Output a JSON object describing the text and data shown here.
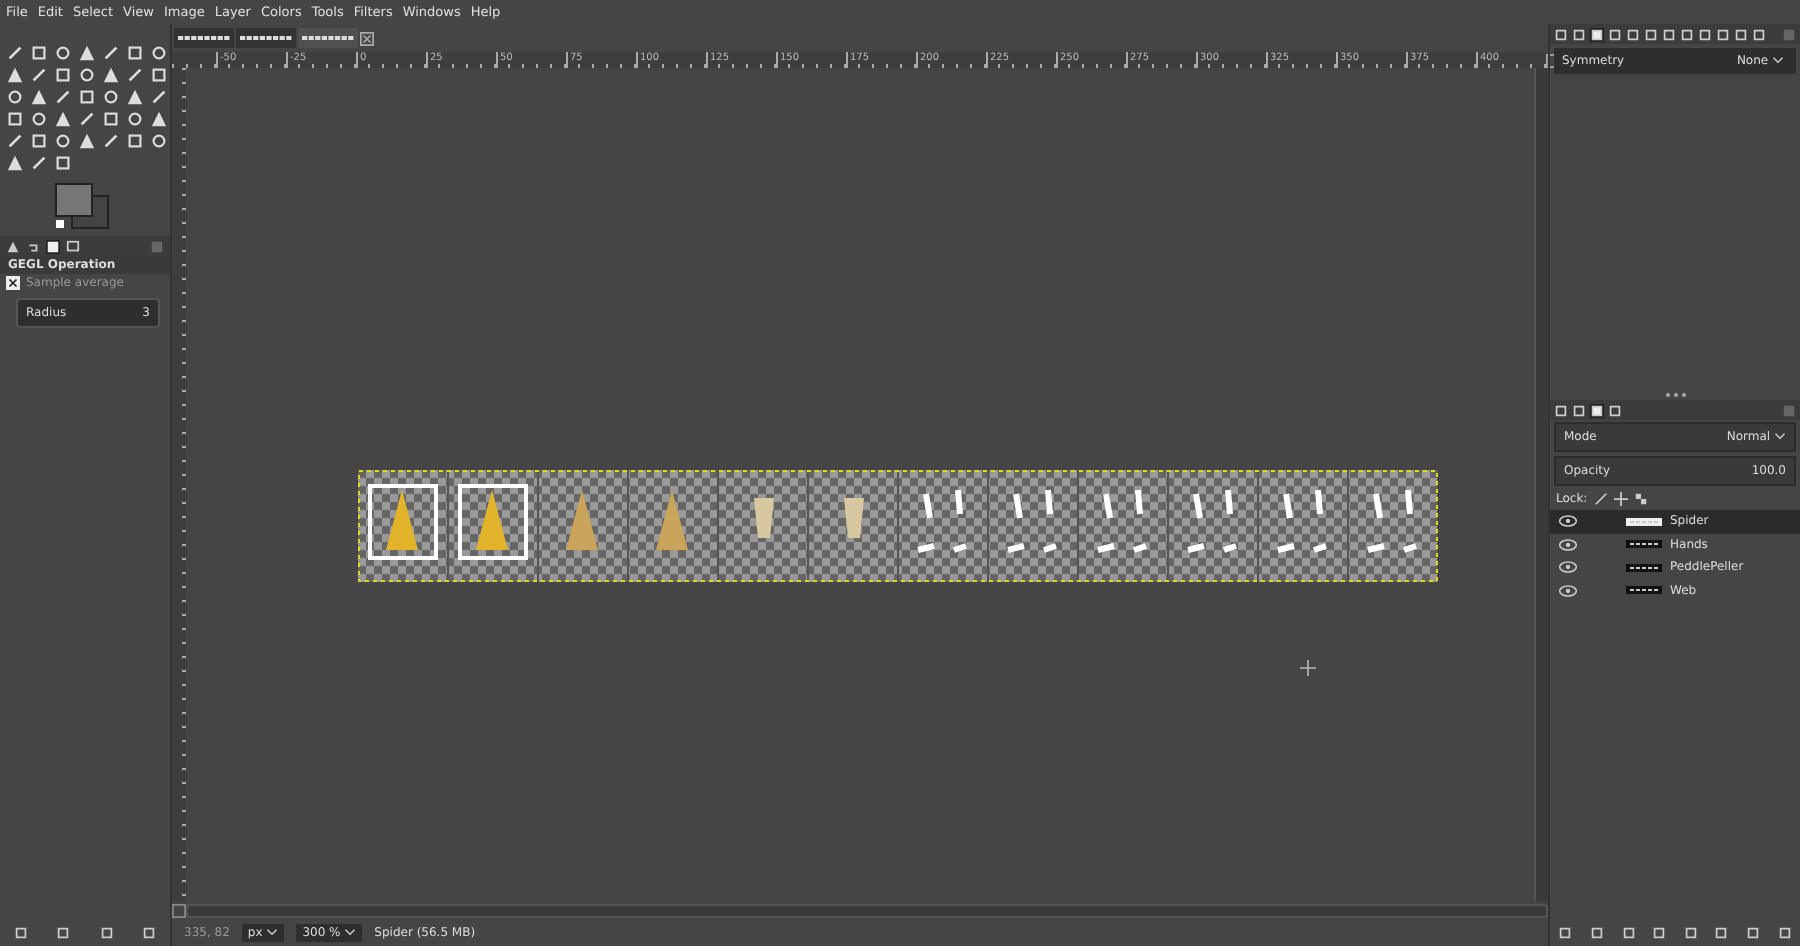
{
  "menu": [
    "File",
    "Edit",
    "Select",
    "View",
    "Image",
    "Layer",
    "Colors",
    "Tools",
    "Filters",
    "Windows",
    "Help"
  ],
  "image_tabs": [
    {
      "selected": false
    },
    {
      "selected": false
    },
    {
      "selected": true
    }
  ],
  "ruler_labels": [
    "-50",
    "-25",
    "0",
    "25",
    "50",
    "75",
    "100",
    "125",
    "150",
    "175",
    "200",
    "225",
    "250",
    "275",
    "300",
    "325",
    "350",
    "375",
    "400"
  ],
  "tool_options": {
    "title": "GEGL Operation",
    "operation": "Sample average",
    "radius_label": "Radius",
    "radius_value": "3"
  },
  "symmetry": {
    "label": "Symmetry",
    "value": "None"
  },
  "layers_panel": {
    "mode_label": "Mode",
    "mode_value": "Normal",
    "opacity_label": "Opacity",
    "opacity_value": "100.0",
    "lock_label": "Lock:",
    "layers": [
      {
        "name": "Spider",
        "visible": true,
        "selected": true
      },
      {
        "name": "Hands",
        "visible": true,
        "selected": false
      },
      {
        "name": "PeddlePeller",
        "visible": true,
        "selected": false
      },
      {
        "name": "Web",
        "visible": true,
        "selected": false
      }
    ]
  },
  "status_bar": {
    "coordinates": "335, 82",
    "unit": "px",
    "zoom": "300 %",
    "info": "Spider (56.5 MB)"
  }
}
